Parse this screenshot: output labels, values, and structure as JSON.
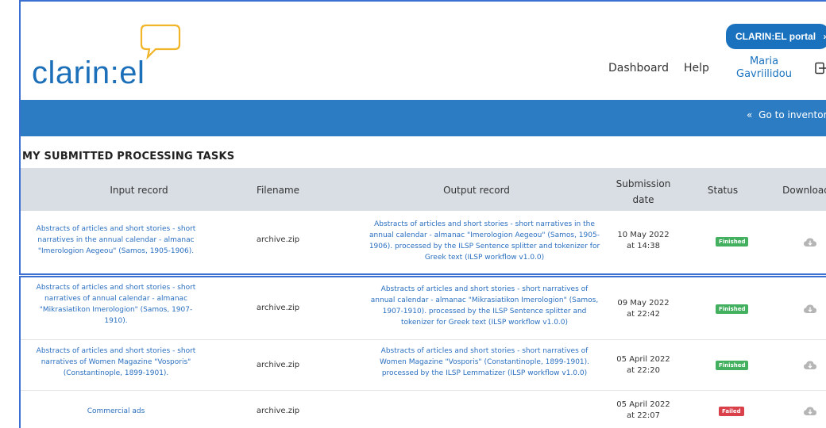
{
  "brand": {
    "logo_text": "clarin:el"
  },
  "header": {
    "portal_button": "CLARIN:EL portal",
    "portal_chevron": "›",
    "nav": {
      "dashboard": "Dashboard",
      "help": "Help"
    },
    "user": {
      "line1": "Maria",
      "line2": "Gavriilidou"
    }
  },
  "bar": {
    "goto_label": "Go to inventory",
    "goto_icon": "«"
  },
  "section": {
    "title": "MY SUBMITTED PROCESSING TASKS"
  },
  "table": {
    "headers": {
      "input": "Input record",
      "filename": "Filename",
      "output": "Output record",
      "date_line1": "Submission",
      "date_line2": "date",
      "status": "Status",
      "download": "Download"
    },
    "rows": [
      {
        "input": [
          "Abstracts of articles and short stories - short",
          "narratives in the annual calendar - almanac",
          "\"Imerologion Aegeou\" (Samos, 1905-1906)."
        ],
        "filename": "archive.zip",
        "output": [
          "Abstracts of articles and short stories - short narratives in the",
          "annual calendar - almanac \"Imerologion Aegeou\" (Samos, 1905-",
          "1906). processed by the ILSP Sentence splitter and tokenizer for",
          "Greek text (ILSP workflow v1.0.0)"
        ],
        "date": [
          "10 May 2022",
          "at 14:38"
        ],
        "status": "Finished"
      },
      {
        "input": [
          "Abstracts of articles and short stories - short",
          "narratives of annual calendar - almanac",
          "\"Mikrasiatikon Imerologion\" (Samos, 1907-",
          "1910)."
        ],
        "filename": "archive.zip",
        "output": [
          "Abstracts of articles and short stories - short narratives of",
          "annual calendar - almanac \"Mikrasiatikon Imerologion\" (Samos,",
          "1907-1910). processed by the ILSP Sentence splitter and",
          "tokenizer for Greek text (ILSP workflow v1.0.0)"
        ],
        "date": [
          "09 May 2022",
          "at 22:42"
        ],
        "status": "Finished"
      },
      {
        "input": [
          "Abstracts of articles and short stories - short",
          "narratives of Women Magazine \"Vosporis\"",
          "(Constantinople, 1899-1901)."
        ],
        "filename": "archive.zip",
        "output": [
          "Abstracts of articles and short stories - short narratives of",
          "Women Magazine \"Vosporis\" (Constantinople, 1899-1901).",
          "processed by the ILSP Lemmatizer (ILSP workflow v1.0.0)"
        ],
        "date": [
          "05 April 2022",
          "at 22:20"
        ],
        "status": "Finished"
      },
      {
        "input": [
          "Commercial ads"
        ],
        "filename": "archive.zip",
        "output": [],
        "date": [
          "05 April 2022",
          "at 22:07"
        ],
        "status": "Failed"
      }
    ]
  },
  "icons": {
    "download": "cloud-download-icon",
    "menu": "logout-icon",
    "logo": "speech-bubble-icon"
  },
  "colors": {
    "brand_blue": "#1a72bf",
    "bar_blue": "#2c7cc4",
    "finished": "#43b060",
    "failed": "#d9404a",
    "header_gray": "#d9dee4"
  }
}
